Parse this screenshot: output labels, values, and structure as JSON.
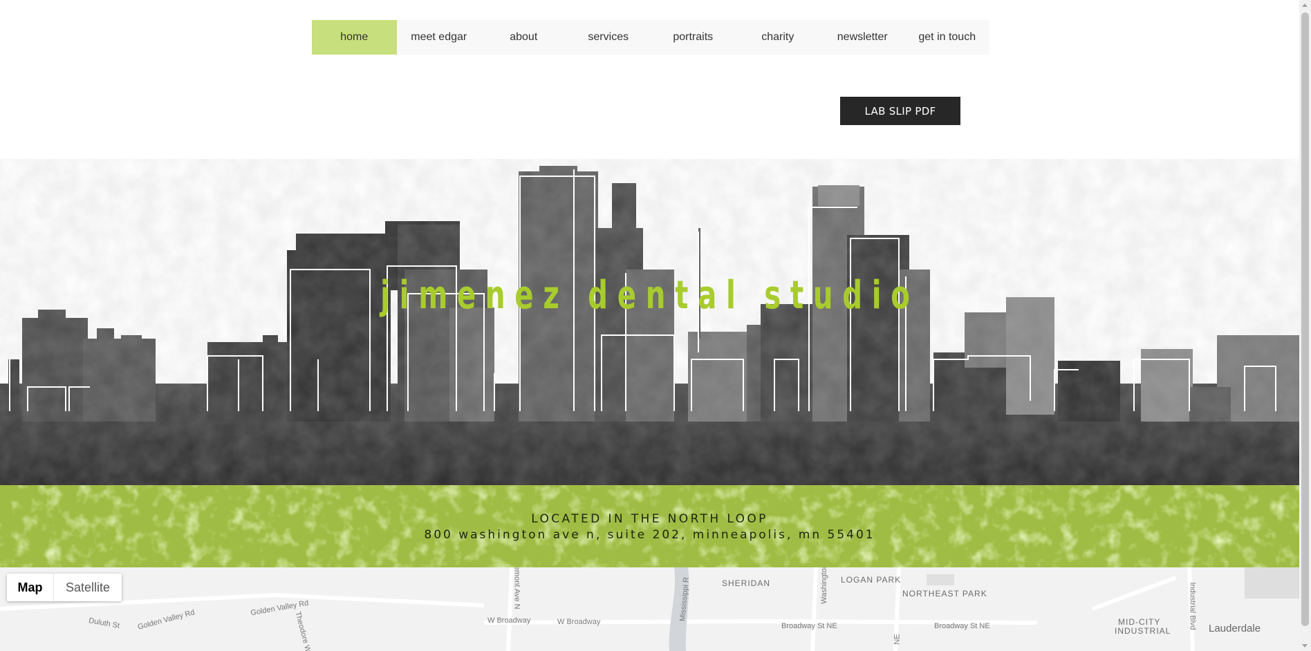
{
  "nav": {
    "items": [
      {
        "label": "home",
        "active": true
      },
      {
        "label": "meet edgar",
        "active": false
      },
      {
        "label": "about",
        "active": false
      },
      {
        "label": "services",
        "active": false
      },
      {
        "label": "portraits",
        "active": false
      },
      {
        "label": "charity",
        "active": false
      },
      {
        "label": "newsletter",
        "active": false
      },
      {
        "label": "get in touch",
        "active": false
      }
    ]
  },
  "lab_button": {
    "label": "LAB SLIP PDF"
  },
  "hero": {
    "title": "jimenez dental studio"
  },
  "location": {
    "heading": "LOCATED IN THE NORTH LOOP",
    "address": "800 washington ave n, suite 202, minneapolis, mn 55401"
  },
  "map": {
    "map_label": "Map",
    "satellite_label": "Satellite",
    "neighborhoods": [
      "SHERIDAN",
      "LOGAN PARK",
      "NORTHEAST PARK",
      "MID-CITY",
      "INDUSTRIAL",
      "Lauderdale"
    ],
    "streets": [
      "Duluth St",
      "Golden Valley Rd",
      "Golden Valley Rd",
      "W Broadway",
      "W Broadway",
      "Broadway St NE",
      "Broadway St NE",
      "Mississippi R",
      "Washington",
      "Fremont Ave N",
      "Industrial Blvd",
      "Theodore Wirth",
      "NE"
    ]
  },
  "colors": {
    "accent": "#c7df7c",
    "title_green": "#a8cc2d",
    "band_green": "#9fbd44",
    "button_dark": "#272727"
  }
}
